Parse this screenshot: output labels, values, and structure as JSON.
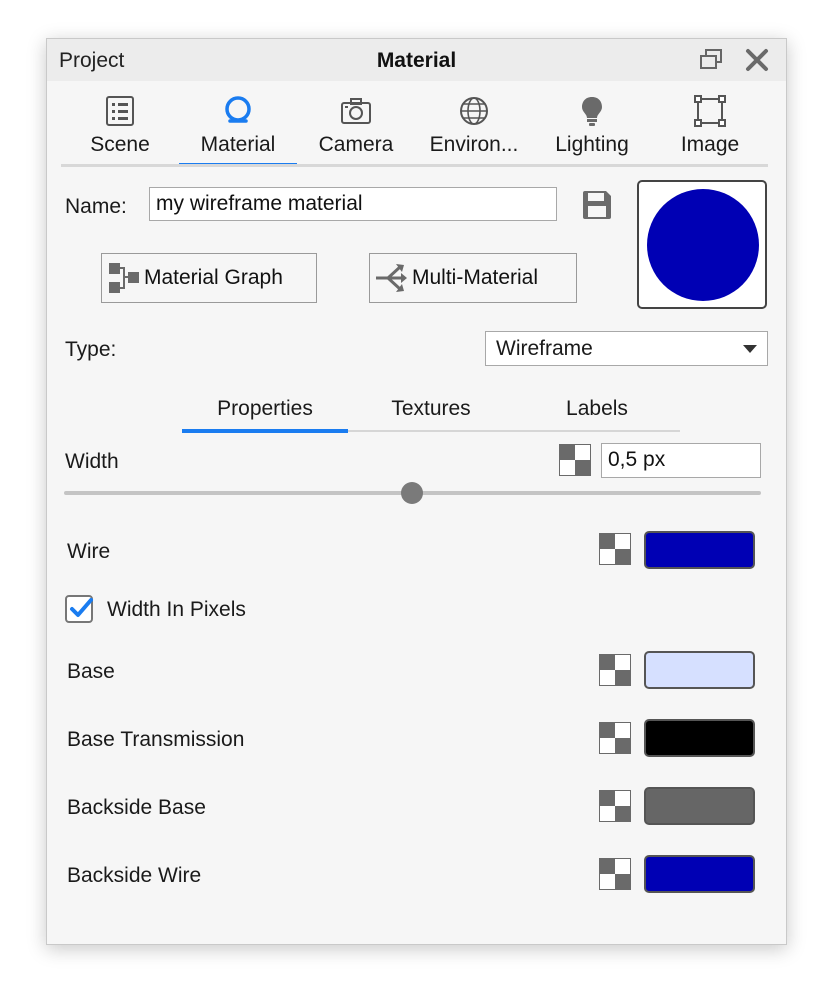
{
  "titlebar": {
    "left_label": "Project",
    "title": "Material"
  },
  "tabs": [
    {
      "label": "Scene",
      "icon": "list-icon"
    },
    {
      "label": "Material",
      "icon": "material-icon"
    },
    {
      "label": "Camera",
      "icon": "camera-icon"
    },
    {
      "label": "Environ...",
      "icon": "globe-icon"
    },
    {
      "label": "Lighting",
      "icon": "bulb-icon"
    },
    {
      "label": "Image",
      "icon": "image-frame-icon"
    }
  ],
  "active_tab": "Material",
  "name": {
    "label": "Name:",
    "value": "my wireframe material"
  },
  "buttons": {
    "graph": "Material Graph",
    "multi": "Multi-Material"
  },
  "type": {
    "label": "Type:",
    "value": "Wireframe"
  },
  "subtabs": [
    "Properties",
    "Textures",
    "Labels"
  ],
  "active_subtab": "Properties",
  "width": {
    "label": "Width",
    "value": "0,5 px",
    "slider_fraction": 0.5
  },
  "properties": [
    {
      "label": "Wire",
      "color": "#0000b4"
    },
    {
      "label": "Base",
      "color": "#d6e0ff"
    },
    {
      "label": "Base Transmission",
      "color": "#000000"
    },
    {
      "label": "Backside Base",
      "color": "#666666"
    },
    {
      "label": "Backside Wire",
      "color": "#0000b4"
    }
  ],
  "checkbox": {
    "label": "Width In Pixels",
    "checked": true
  },
  "preview_color": "#0000b4",
  "accent": "#1a7cf0"
}
